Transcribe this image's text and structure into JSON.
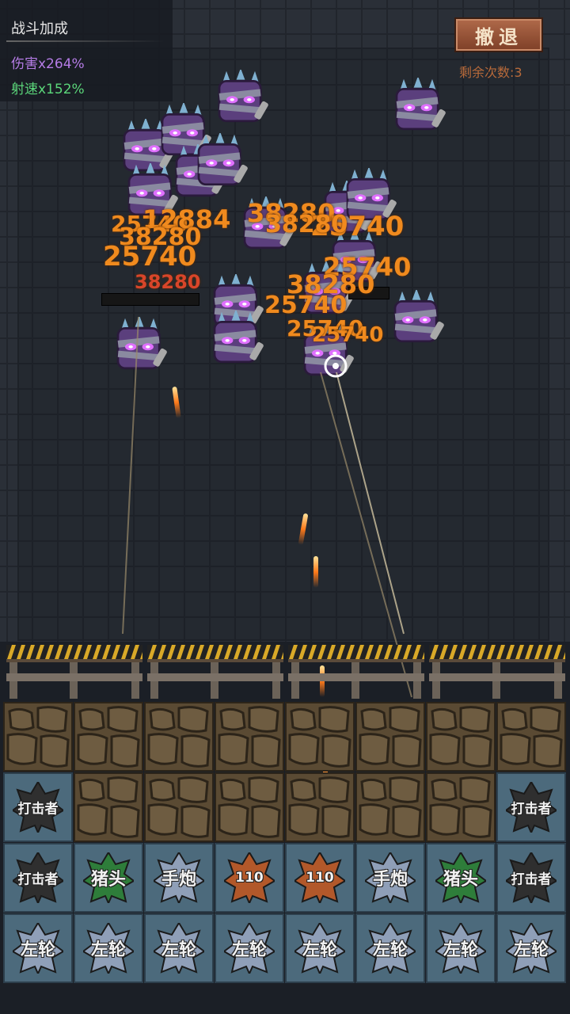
{
  "buff": {
    "title": "战斗加成",
    "damage": "伤害x264%",
    "speed": "射速x152%"
  },
  "retreat": {
    "label": "撤退",
    "remaining": "剩余次数:3"
  },
  "damage_numbers": [
    {
      "text": "25740",
      "color": "orange"
    },
    {
      "text": "12884",
      "color": "orange"
    },
    {
      "text": "38280",
      "color": "orange"
    },
    {
      "text": "38280",
      "color": "orange"
    },
    {
      "text": "25740",
      "color": "orange"
    },
    {
      "text": "38280",
      "color": "orange"
    },
    {
      "text": "25740",
      "color": "orange"
    },
    {
      "text": "25740",
      "color": "orange"
    },
    {
      "text": "38280",
      "color": "orange"
    },
    {
      "text": "25740",
      "color": "orange"
    },
    {
      "text": "38280",
      "color": "red"
    },
    {
      "text": "25740",
      "color": "orange"
    },
    {
      "text": "25740",
      "color": "orange"
    }
  ],
  "board": {
    "row1": [
      "",
      "",
      "",
      "",
      "",
      "",
      "",
      ""
    ],
    "row2": [
      "打击者",
      "",
      "",
      "",
      "",
      "",
      "",
      "打击者"
    ],
    "row3": [
      "打击者",
      "猪头",
      "手炮",
      "110",
      "110",
      "手炮",
      "猪头",
      "打击者"
    ],
    "row4": [
      "左轮",
      "左轮",
      "左轮",
      "左轮",
      "左轮",
      "左轮",
      "左轮",
      "左轮"
    ]
  },
  "colors": {
    "damage_orange": "#f08a1e",
    "damage_red": "#d8452a",
    "buff_damage": "#b57ce6",
    "buff_speed": "#5bd67a",
    "tile_dark": "#2f2f2f",
    "tile_green": "#2e7d3a",
    "tile_silver": "#8f9fb8",
    "tile_orange": "#b2582a"
  }
}
